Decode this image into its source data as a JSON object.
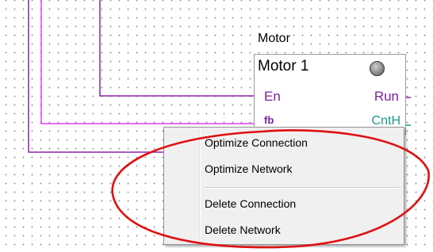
{
  "block": {
    "type_label": "Motor",
    "name": "Motor 1",
    "pins": {
      "en": "En",
      "run": "Run",
      "fb": "fb",
      "cnth": "CntH"
    },
    "status_lamp": "gray-lamp-icon"
  },
  "context_menu": {
    "items": [
      "Optimize Connection",
      "Optimize Network",
      "Delete Connection",
      "Delete Network"
    ]
  },
  "colors": {
    "wire_purple": "#8e24aa",
    "wire_magenta": "#e040fb",
    "highlight_red": "#e01010"
  }
}
